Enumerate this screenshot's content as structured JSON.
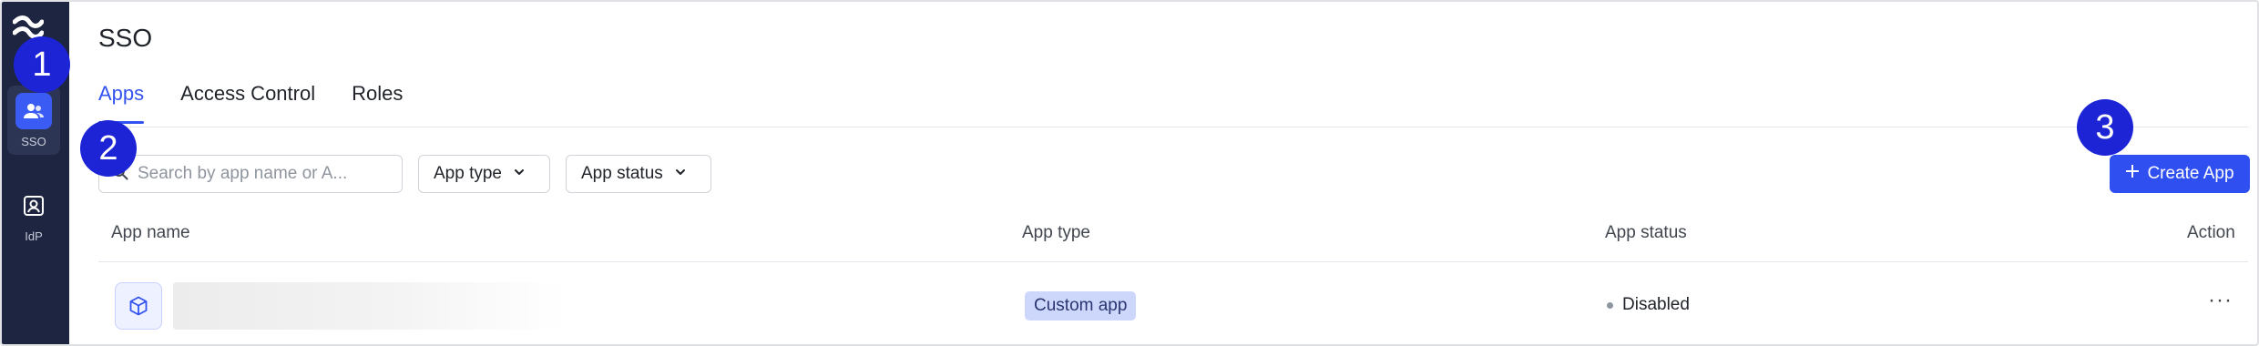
{
  "sidebar": {
    "items": [
      {
        "label": "SSO",
        "icon": "users-icon",
        "active": true
      },
      {
        "label": "IdP",
        "icon": "id-card-icon",
        "active": false
      }
    ]
  },
  "header": {
    "title": "SSO"
  },
  "tabs": [
    {
      "label": "Apps",
      "active": true
    },
    {
      "label": "Access Control",
      "active": false
    },
    {
      "label": "Roles",
      "active": false
    }
  ],
  "toolbar": {
    "search_placeholder": "Search by app name or A...",
    "filter_type_label": "App type",
    "filter_status_label": "App status",
    "create_label": "Create App"
  },
  "table": {
    "columns": [
      "App name",
      "App type",
      "App status",
      "Action"
    ],
    "rows": [
      {
        "app_name": "",
        "app_type": "Custom app",
        "app_status": "Disabled",
        "action": "···"
      }
    ]
  },
  "markers": [
    "1",
    "2",
    "3"
  ],
  "colors": {
    "accent": "#2f4ff0",
    "sidebar_bg": "#1e2540",
    "badge_bg": "#cdd7fc",
    "marker": "#1c24d6"
  }
}
